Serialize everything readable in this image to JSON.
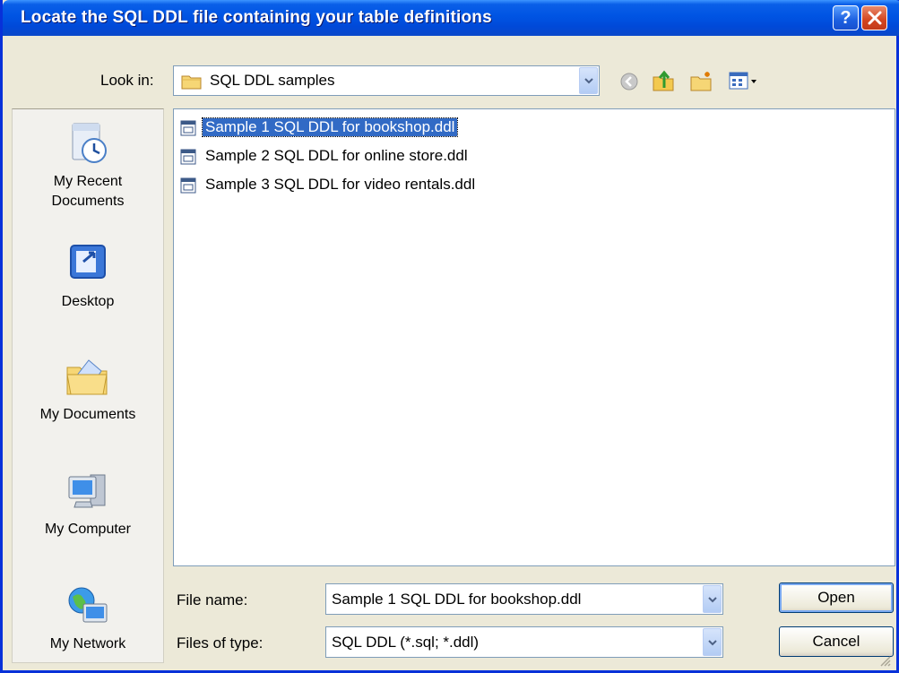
{
  "window": {
    "title": "Locate the SQL DDL file containing your table definitions"
  },
  "titlebar": {
    "help_label": "?",
    "close_label": "✕"
  },
  "toolbar": {
    "look_in_label": "Look in:",
    "look_in_value": "SQL DDL samples",
    "icons": [
      "back-icon",
      "up-folder-icon",
      "new-folder-icon",
      "views-menu-icon"
    ]
  },
  "places": [
    {
      "label": "My Recent Documents",
      "icon": "recent-documents-icon"
    },
    {
      "label": "Desktop",
      "icon": "desktop-icon"
    },
    {
      "label": "My Documents",
      "icon": "my-documents-icon"
    },
    {
      "label": "My Computer",
      "icon": "my-computer-icon"
    },
    {
      "label": "My Network",
      "icon": "my-network-icon"
    }
  ],
  "files": [
    {
      "name": "Sample 1 SQL DDL for bookshop.ddl",
      "selected": true
    },
    {
      "name": "Sample 2 SQL DDL for online store.ddl",
      "selected": false
    },
    {
      "name": "Sample 3 SQL DDL for video rentals.ddl",
      "selected": false
    }
  ],
  "footer": {
    "file_name_label": "File name:",
    "file_name_value": "Sample 1 SQL DDL for bookshop.ddl",
    "file_type_label": "Files of type:",
    "file_type_value": "SQL DDL (*.sql; *.ddl)",
    "open_label": "Open",
    "cancel_label": "Cancel"
  },
  "colors": {
    "title_blue": "#0054e3",
    "selection": "#316ac5",
    "face": "#ece9d8"
  }
}
